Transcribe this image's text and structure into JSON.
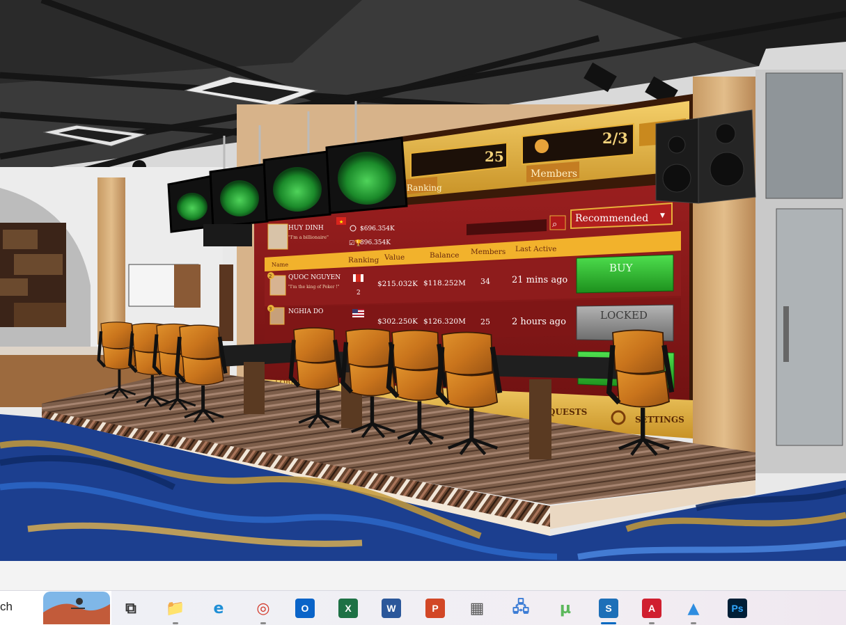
{
  "scene": {
    "lobby_app": {
      "ranking_value": "25",
      "ranking_label": "Ranking",
      "members_count": "2/3",
      "members_label": "Members",
      "search_placeholder": "",
      "sort_selected": "Recommended",
      "profile": {
        "name": "HUY DINH",
        "motto": "\"I'm a billionaire\"",
        "chips": "$696.354K",
        "trophy": "896.354K"
      },
      "table_headers": [
        "Name",
        "Ranking",
        "Value",
        "Balance",
        "Members",
        "Last Active"
      ],
      "rows": [
        {
          "rank_badge": "2",
          "name": "QUOC NGUYEN",
          "motto": "\"I'm the king of Poker !\"",
          "ranking": "2",
          "value": "$215.032K",
          "balance": "$118.252M",
          "members": "34",
          "last_active": "21 mins ago",
          "action": "BUY"
        },
        {
          "rank_badge": "3",
          "name": "NGHIA DO",
          "motto": "",
          "ranking": "",
          "value": "$302.250K",
          "balance": "$126.320M",
          "members": "25",
          "last_active": "2 hours ago",
          "action": "LOCKED"
        }
      ],
      "footer_items": [
        "LOBBY",
        "QUESTS",
        "SETTINGS"
      ]
    },
    "colors": {
      "board_red": "#8c1a1a",
      "gold": "#e8b23a",
      "buy_green": "#2fb52f",
      "locked_gray": "#8a8a8a",
      "carpet_blue": "#1c3f8f"
    }
  },
  "taskbar": {
    "search_text": "ch",
    "icons": [
      {
        "name": "task-view-icon",
        "glyph": "⧉"
      },
      {
        "name": "file-explorer-icon",
        "glyph": "📁"
      },
      {
        "name": "edge-icon",
        "glyph": "e"
      },
      {
        "name": "chrome-icon",
        "glyph": "◎"
      },
      {
        "name": "outlook-icon",
        "glyph": "O"
      },
      {
        "name": "excel-icon",
        "glyph": "X"
      },
      {
        "name": "word-icon",
        "glyph": "W"
      },
      {
        "name": "powerpoint-icon",
        "glyph": "P"
      },
      {
        "name": "calculator-icon",
        "glyph": "▦"
      },
      {
        "name": "network-icon",
        "glyph": "🖧"
      },
      {
        "name": "utorrent-icon",
        "glyph": "µ"
      },
      {
        "name": "sketchup-icon",
        "glyph": "S"
      },
      {
        "name": "acrobat-icon",
        "glyph": "A"
      },
      {
        "name": "photos-icon",
        "glyph": "▲"
      },
      {
        "name": "photoshop-icon",
        "glyph": "Ps"
      }
    ]
  }
}
